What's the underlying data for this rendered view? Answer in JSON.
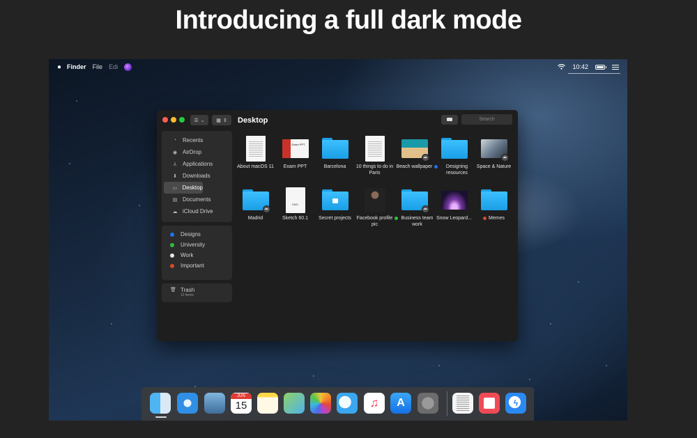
{
  "headline": "Introducing a full dark mode",
  "menubar": {
    "apple": "",
    "app_name": "Finder",
    "menus": [
      "File",
      "Edi"
    ],
    "time": "10:42"
  },
  "finder": {
    "title": "Desktop",
    "search_placeholder": "Search",
    "favorites": [
      {
        "label": "Recents",
        "icon": "clock-icon",
        "glyph": "◔"
      },
      {
        "label": "AirDrop",
        "icon": "airdrop-icon",
        "glyph": "◉"
      },
      {
        "label": "Applications",
        "icon": "applications-icon",
        "glyph": "⅄"
      },
      {
        "label": "Downloads",
        "icon": "downloads-icon",
        "glyph": "⬇"
      },
      {
        "label": "Desktop",
        "icon": "desktop-icon",
        "glyph": "▭",
        "active": true
      },
      {
        "label": "Documents",
        "icon": "documents-icon",
        "glyph": "▤"
      },
      {
        "label": "iCloud Drive",
        "icon": "cloud-icon",
        "glyph": "☁"
      }
    ],
    "tags": [
      {
        "label": "Designs",
        "color": "#1f73e8"
      },
      {
        "label": "University",
        "color": "#2fbf3a"
      },
      {
        "label": "Work",
        "color": "#e6e6e6"
      },
      {
        "label": "Important",
        "color": "#d5492d"
      }
    ],
    "trash": {
      "label": "Trash",
      "subtitle": "12 items"
    },
    "items": [
      {
        "label": "About macOS 11",
        "kind": "doc"
      },
      {
        "label": "Exam PPT",
        "kind": "ppt",
        "thumb_text": "Exam PPT"
      },
      {
        "label": "Barcelona",
        "kind": "folder"
      },
      {
        "label": "10 things to do in Paris",
        "kind": "doc"
      },
      {
        "label": "Beach wallpaper",
        "kind": "photo-beach",
        "cloud": true
      },
      {
        "label": "Designing resources",
        "kind": "folder",
        "tag_color": "#1f73e8"
      },
      {
        "label": "Space & Nature",
        "kind": "photo-space",
        "cloud": true
      },
      {
        "label": "Madrid",
        "kind": "folder",
        "cloud": true
      },
      {
        "label": "Sketch 60.1",
        "kind": "doc-sketch",
        "thumb_text": "DMG"
      },
      {
        "label": "Secret projects",
        "kind": "folder-lock"
      },
      {
        "label": "Facebook profile pic",
        "kind": "photo-person"
      },
      {
        "label": "Business team work",
        "kind": "folder",
        "tag_color": "#2fbf3a",
        "cloud": true
      },
      {
        "label": "Snow Leopard...",
        "kind": "photo-snow"
      },
      {
        "label": "Memes",
        "kind": "folder",
        "tag_color": "#d5492d"
      }
    ]
  },
  "dock": {
    "calendar_month": "JUN",
    "calendar_day": "15",
    "apps": [
      {
        "name": "finder-app-icon",
        "bg": "linear-gradient(90deg,#4fb4f2 50%,#d8e9f5 50%)"
      },
      {
        "name": "safari-app-icon",
        "bg": "radial-gradient(circle,#e8f4ff 0 25%,#2e8fe4 27%)"
      },
      {
        "name": "preview-app-icon",
        "bg": "linear-gradient(#7fb6e0,#3f6d9a)"
      },
      {
        "name": "calendar-app-icon",
        "bg": "#ffffff"
      },
      {
        "name": "notes-app-icon",
        "bg": "linear-gradient(#ffd84a 0 22%,#fff9e6 22%)"
      },
      {
        "name": "maps-app-icon",
        "bg": "linear-gradient(135deg,#8fd36a,#4fb1e8)"
      },
      {
        "name": "photos-app-icon",
        "bg": "conic-gradient(#f0c33a,#f58a2a,#e2473c,#b845c6,#4a6ee8,#3bb8e0,#58c34a,#f0c33a)"
      },
      {
        "name": "messages-app-icon",
        "bg": "radial-gradient(circle at 40% 45%,#f4fbff 0 35%,#3aa7f0 37%)"
      },
      {
        "name": "music-app-icon",
        "bg": "#ffffff"
      },
      {
        "name": "app-store-app-icon",
        "bg": "linear-gradient(#3aa7f5,#1670e6)"
      },
      {
        "name": "system-preferences-app-icon",
        "bg": "radial-gradient(circle,#9a9a9a 0 40%,#6c6c6c 42%)"
      },
      {
        "name": "document-app-icon",
        "bg": "#f4f4f4"
      },
      {
        "name": "news-app-icon",
        "bg": "#f04a57"
      },
      {
        "name": "messenger-app-icon",
        "bg": "radial-gradient(circle at 45% 45%,#ffffff 0 36%,#2a8af2 38%)"
      }
    ]
  }
}
